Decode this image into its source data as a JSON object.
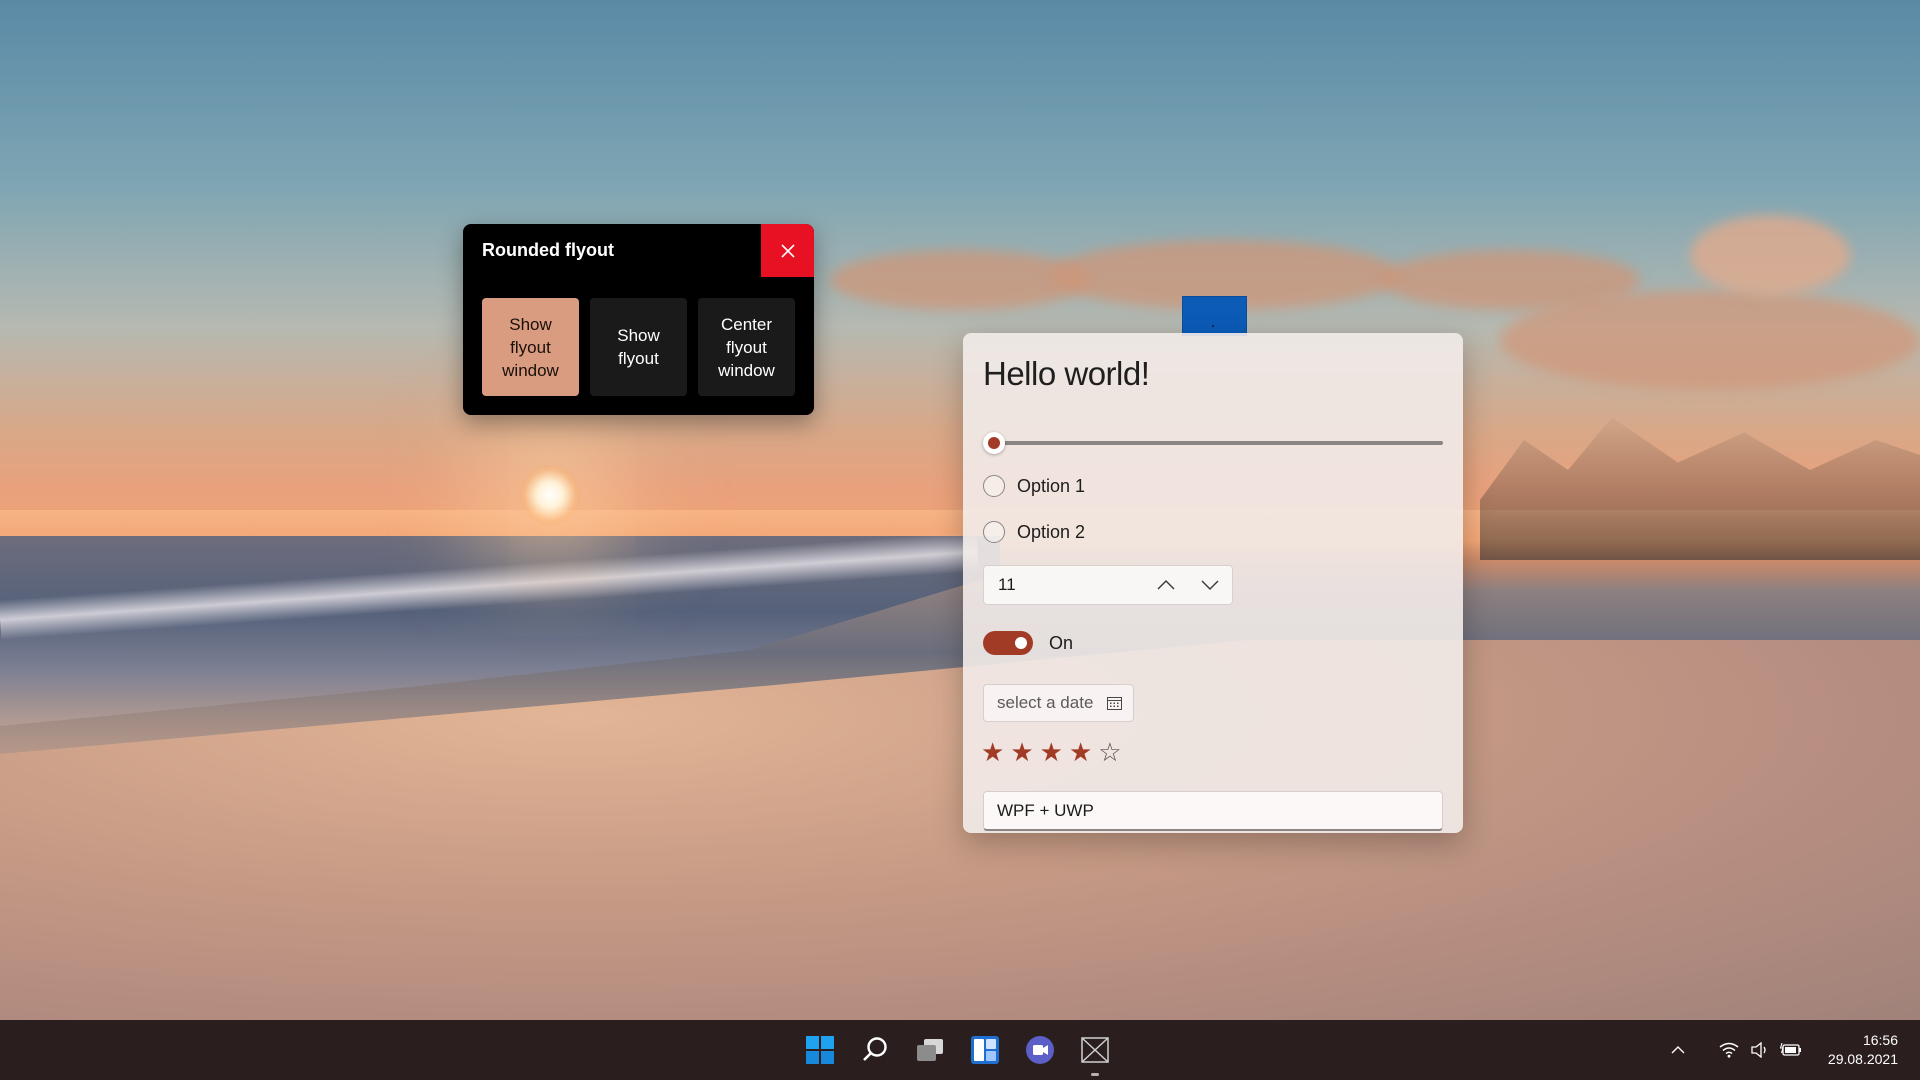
{
  "flyout": {
    "title": "Rounded flyout",
    "buttons": [
      {
        "label": "Show flyout window"
      },
      {
        "label": "Show flyout"
      },
      {
        "label": "Center flyout window"
      }
    ]
  },
  "card": {
    "title": "Hello world!",
    "slider_value": 0,
    "radios": [
      {
        "label": "Option 1",
        "checked": false
      },
      {
        "label": "Option 2",
        "checked": false
      }
    ],
    "number_box": {
      "value": "11"
    },
    "toggle": {
      "label": "On",
      "checked": true
    },
    "date_picker": {
      "placeholder": "select a date"
    },
    "rating": {
      "value": 4,
      "max": 5
    },
    "textbox": {
      "value": "WPF + UWP"
    }
  },
  "taskbar": {
    "apps": [
      "start-icon",
      "search-icon",
      "task-view-icon",
      "widgets-icon",
      "teams-chat-icon",
      "app-icon"
    ],
    "clock": {
      "time": "16:56",
      "date": "29.08.2021"
    }
  },
  "colors": {
    "accent": "#a23b26",
    "flyout_accent_button": "#d99c81",
    "close_button": "#e81123",
    "blue_square": "#0b5bb7",
    "taskbar": "#2a1e1e"
  }
}
